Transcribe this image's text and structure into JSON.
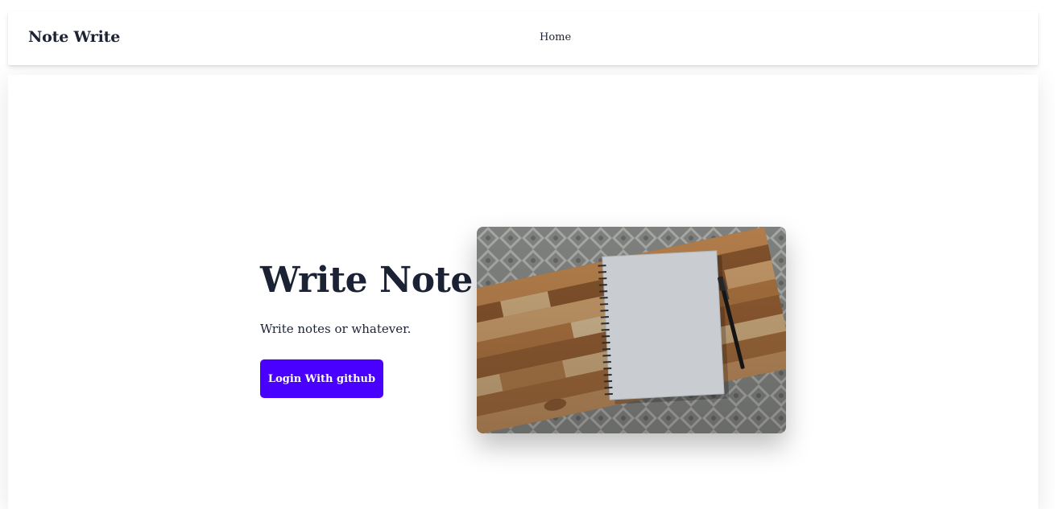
{
  "navbar": {
    "brand": "Note Write",
    "links": [
      {
        "label": "Home"
      }
    ]
  },
  "hero": {
    "title": "Write Note!",
    "subtitle": "Write notes or whatever.",
    "cta_label": "Login With github",
    "image_alt": "Spiral notebook and pen on a wooden desk"
  },
  "colors": {
    "primary": "#4a00ff",
    "text": "#1a2234",
    "background": "#ffffff"
  }
}
